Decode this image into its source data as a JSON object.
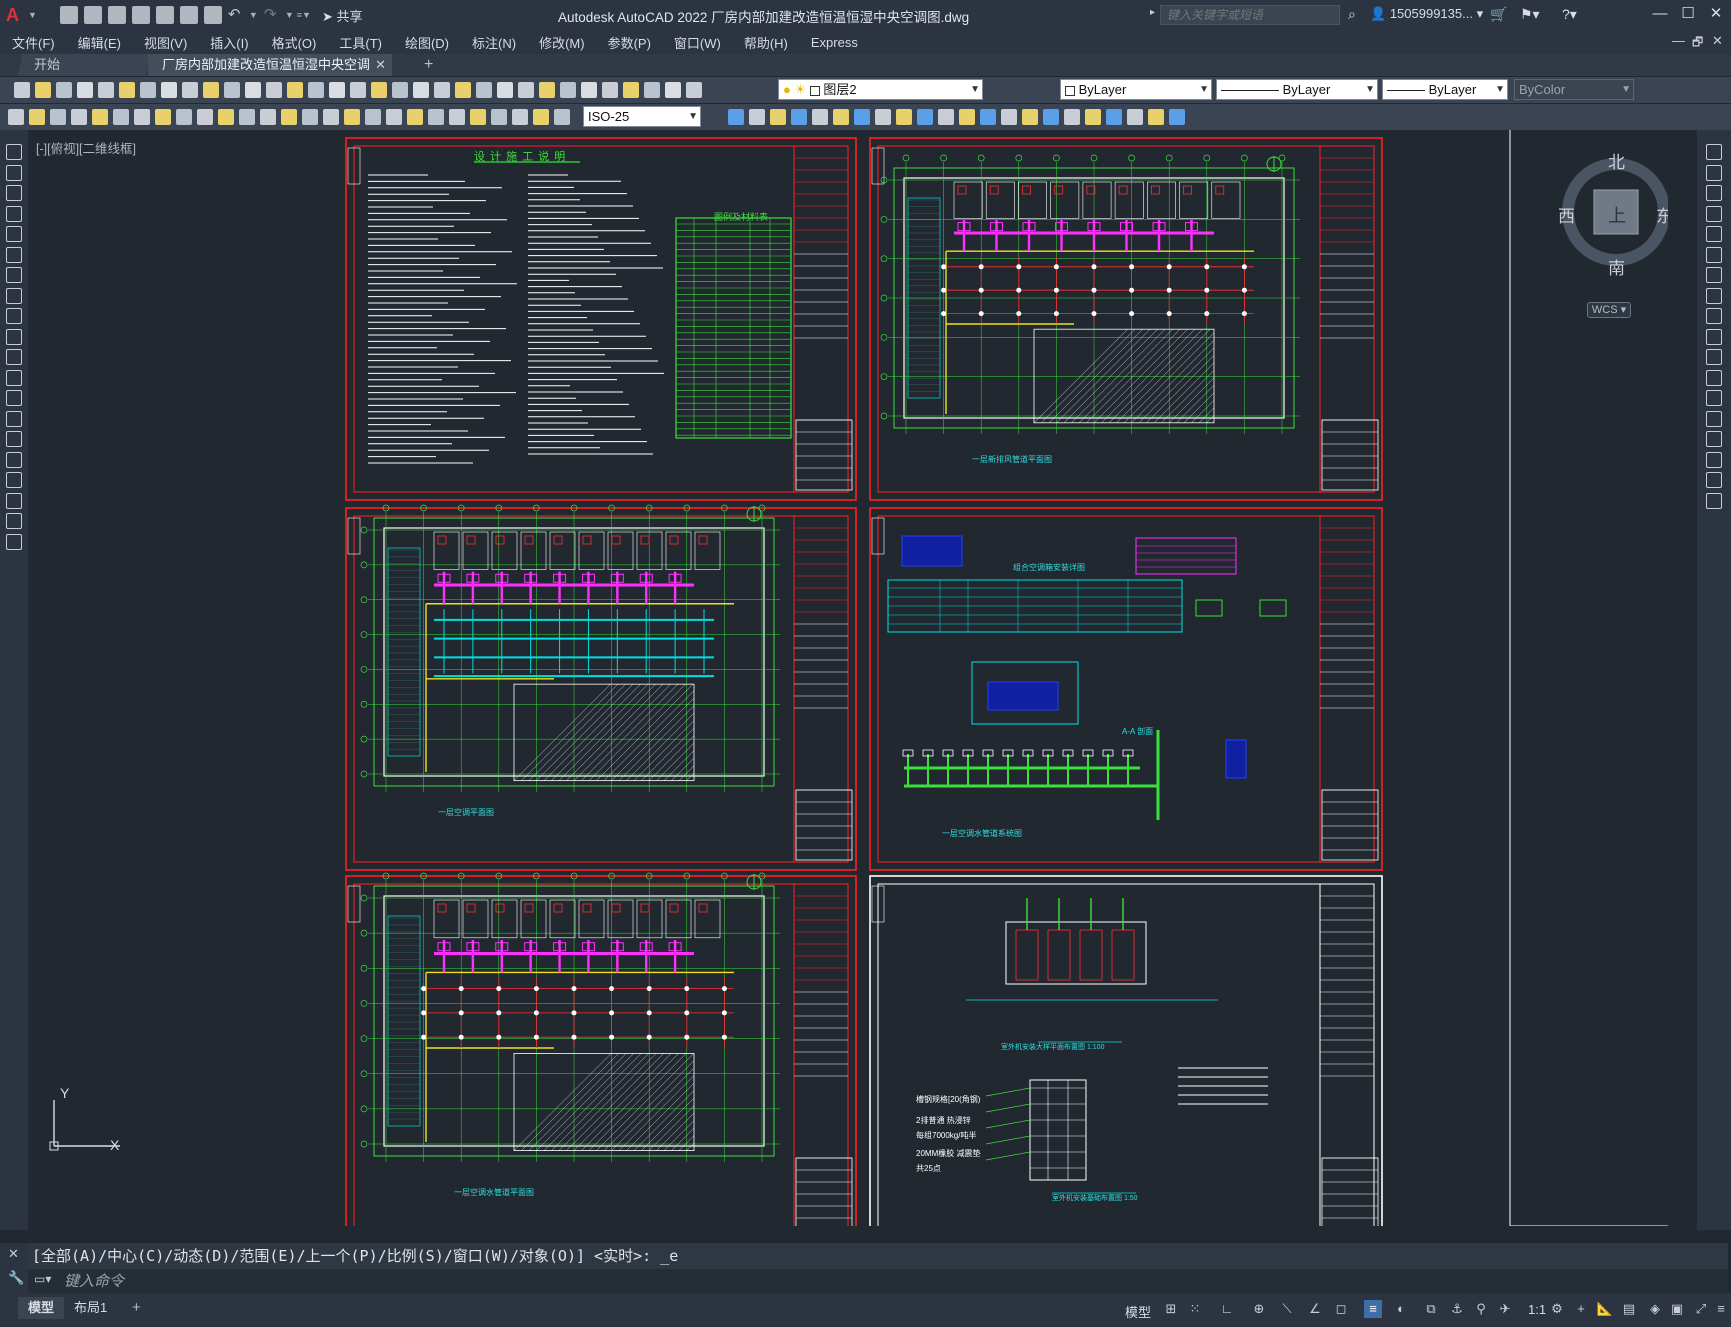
{
  "app": {
    "title": "Autodesk AutoCAD 2022    厂房内部加建改造恒温恒湿中央空调图.dwg",
    "logo": "A",
    "share_label": "共享",
    "search_placeholder": "键入关键字或短语",
    "user_label": "1505999135...",
    "window_buttons": [
      "—",
      "☐",
      "✕"
    ],
    "doc_window_buttons": [
      "—",
      "🗗",
      "✕"
    ]
  },
  "menu": [
    "文件(F)",
    "编辑(E)",
    "视图(V)",
    "插入(I)",
    "格式(O)",
    "工具(T)",
    "绘图(D)",
    "标注(N)",
    "修改(M)",
    "参数(P)",
    "窗口(W)",
    "帮助(H)",
    "Express"
  ],
  "tabs": {
    "start": "开始",
    "document": "厂房内部加建改造恒温恒湿中央空调图*",
    "add": "+"
  },
  "toolbar": {
    "layer_value": "图层2",
    "color_value": "ByLayer",
    "linetype_value": "ByLayer",
    "lineweight_value": "ByLayer",
    "plotstyle_value": "ByColor",
    "dimstyle_value": "ISO-25"
  },
  "canvas": {
    "viewport_label": "[-][俯视][二维线框]",
    "compass": {
      "north": "北",
      "south": "南",
      "east": "东",
      "west": "西",
      "top": "上"
    },
    "wcs_label": "WCS",
    "ucs_x": "X",
    "ucs_y": "Y"
  },
  "sheets": [
    {
      "title": "设 计 施 工 说 明",
      "subtitle": "图例及材料表"
    },
    {
      "caption": "一层新排风管道平面图"
    },
    {
      "caption": "一层空调平面图"
    },
    {
      "caption": "一层空调水管道系统图",
      "extra": "A-A 剖面",
      "note": "组合空调箱安装详图"
    },
    {
      "caption": "一层空调水管道平面图"
    },
    {
      "caption": "室外机安装大样平面布置图 1:100",
      "caption2": "室外机安装基础布置图 1:50",
      "notes": [
        "槽钢规格[20(角钢)",
        "2排普通 热浸锌",
        "每组7000kg/吨半",
        "20MM橡胶 减震垫",
        "共25点"
      ]
    }
  ],
  "command": {
    "history": "[全部(A)/中心(C)/动态(D)/范围(E)/上一个(P)/比例(S)/窗口(W)/对象(O)] <实时>: _e",
    "placeholder": "键入命令"
  },
  "status": {
    "tab_model": "模型",
    "tab_layout": "布局1",
    "tab_add": "+",
    "model_label": "模型",
    "scale_label": "1:1"
  }
}
